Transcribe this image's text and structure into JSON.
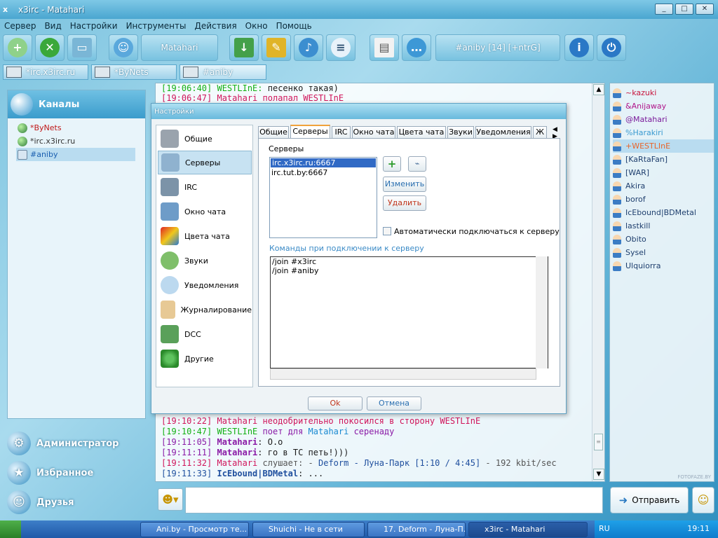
{
  "window": {
    "title": "x3irc - Matahari",
    "icon": "x3irc-logo-icon"
  },
  "menu": [
    "Сервер",
    "Вид",
    "Настройки",
    "Инструменты",
    "Действия",
    "Окно",
    "Помощь"
  ],
  "toolbar": {
    "nick_label": "Matahari",
    "channel_label": "#aniby [14] [+ntrG]",
    "icons": [
      "add-server-icon",
      "connect-icon",
      "monitor-icon",
      "user-icon",
      "download-icon",
      "tools-icon",
      "music-icon",
      "notes-icon",
      "board-icon",
      "chat-bubble-icon",
      "info-icon",
      "power-icon"
    ]
  },
  "channel_tabs": [
    "*irc.x3irc.ru",
    "*ByNets",
    "#aniby"
  ],
  "leftpanel": {
    "header": "Каналы",
    "channels": [
      {
        "name": "*ByNets",
        "color": "#c01818"
      },
      {
        "name": "*irc.x3irc.ru",
        "color": "#333333"
      },
      {
        "name": "#aniby",
        "color": "#1a5fb0"
      }
    ],
    "nav": [
      "Администратор",
      "Избранное",
      "Друзья"
    ]
  },
  "chat": {
    "lines_top": [
      {
        "ts": "[19:06:40]",
        "nick": "WESTLInE:",
        "text": "песенко такая)"
      },
      {
        "ts": "[19:06:47]",
        "nick": "Matahari",
        "text": "полапал WESTLInE"
      }
    ],
    "lines_bottom": [
      {
        "ts": "[19:10:22]",
        "parts": [
          "Matahari неодобрительно покосился в сторону WESTLInE"
        ]
      },
      {
        "ts": "[19:10:47]",
        "parts": [
          "WESTLInE",
          "поет для",
          "Matahari",
          "серенаду"
        ]
      },
      {
        "ts": "[19:11:05]",
        "parts": [
          "Matahari",
          ": O.o"
        ]
      },
      {
        "ts": "[19:11:11]",
        "parts": [
          "Matahari",
          ": го в ТС петь!)))"
        ]
      },
      {
        "ts": "[19:11:32]",
        "parts": [
          "Matahari",
          "слушает: -",
          "Deform - Луна-Парк [1:10 / 4:45]",
          "- 192 kbit/sec"
        ]
      },
      {
        "ts": "[19:11:33]",
        "parts": [
          "IcEbound|BDMetal",
          ": ..."
        ]
      }
    ]
  },
  "nicks": [
    {
      "name": "~kazuki",
      "color": "#c8143c"
    },
    {
      "name": "&Anijaway",
      "color": "#b0158a"
    },
    {
      "name": "@Matahari",
      "color": "#7a1a9a"
    },
    {
      "name": "%Harakiri",
      "color": "#3a9ad0"
    },
    {
      "name": "+WESTLInE",
      "color": "#e8642a"
    },
    {
      "name": "[KaRtaFan]",
      "color": "#1f3f6e"
    },
    {
      "name": "[WAR]",
      "color": "#1f3f6e"
    },
    {
      "name": "Akira",
      "color": "#1f3f6e"
    },
    {
      "name": "borof",
      "color": "#1f3f6e"
    },
    {
      "name": "IcEbound|BDMetal",
      "color": "#1f3f6e"
    },
    {
      "name": "lastkill",
      "color": "#1f3f6e"
    },
    {
      "name": "Obito",
      "color": "#1f3f6e"
    },
    {
      "name": "Sysel",
      "color": "#1f3f6e"
    },
    {
      "name": "Ulquiorra",
      "color": "#1f3f6e"
    }
  ],
  "input": {
    "send_label": "Отправить"
  },
  "dialog": {
    "title": "Настройки",
    "categories": [
      "Общие",
      "Серверы",
      "IRC",
      "Окно чата",
      "Цвета чата",
      "Звуки",
      "Уведомления",
      "Журналирование",
      "DCC",
      "Другие"
    ],
    "tabs": [
      "Общие",
      "Серверы",
      "IRC",
      "Окно чата",
      "Цвета чата",
      "Звуки",
      "Уведомления",
      "Ж"
    ],
    "servers_label": "Серверы",
    "servers": [
      "irc.x3irc.ru:6667",
      "irc.tut.by:6667"
    ],
    "edit_label": "Изменить",
    "delete_label": "Удалить",
    "auto_connect_label": "Автоматически подключаться к серверу",
    "commands_label": "Команды при подключении к серверу",
    "commands": [
      "/join #x3irc",
      "/join #aniby"
    ],
    "ok_label": "Ok",
    "cancel_label": "Отмена"
  },
  "taskbar": {
    "tasks": [
      "Ani.by - Просмотр те...",
      "Shuichi - Не в сети",
      "17. Deform - Луна-П...",
      "x3irc - Matahari"
    ],
    "lang": "RU",
    "clock": "19:11"
  },
  "watermark": "FOTOFAZE.BY"
}
